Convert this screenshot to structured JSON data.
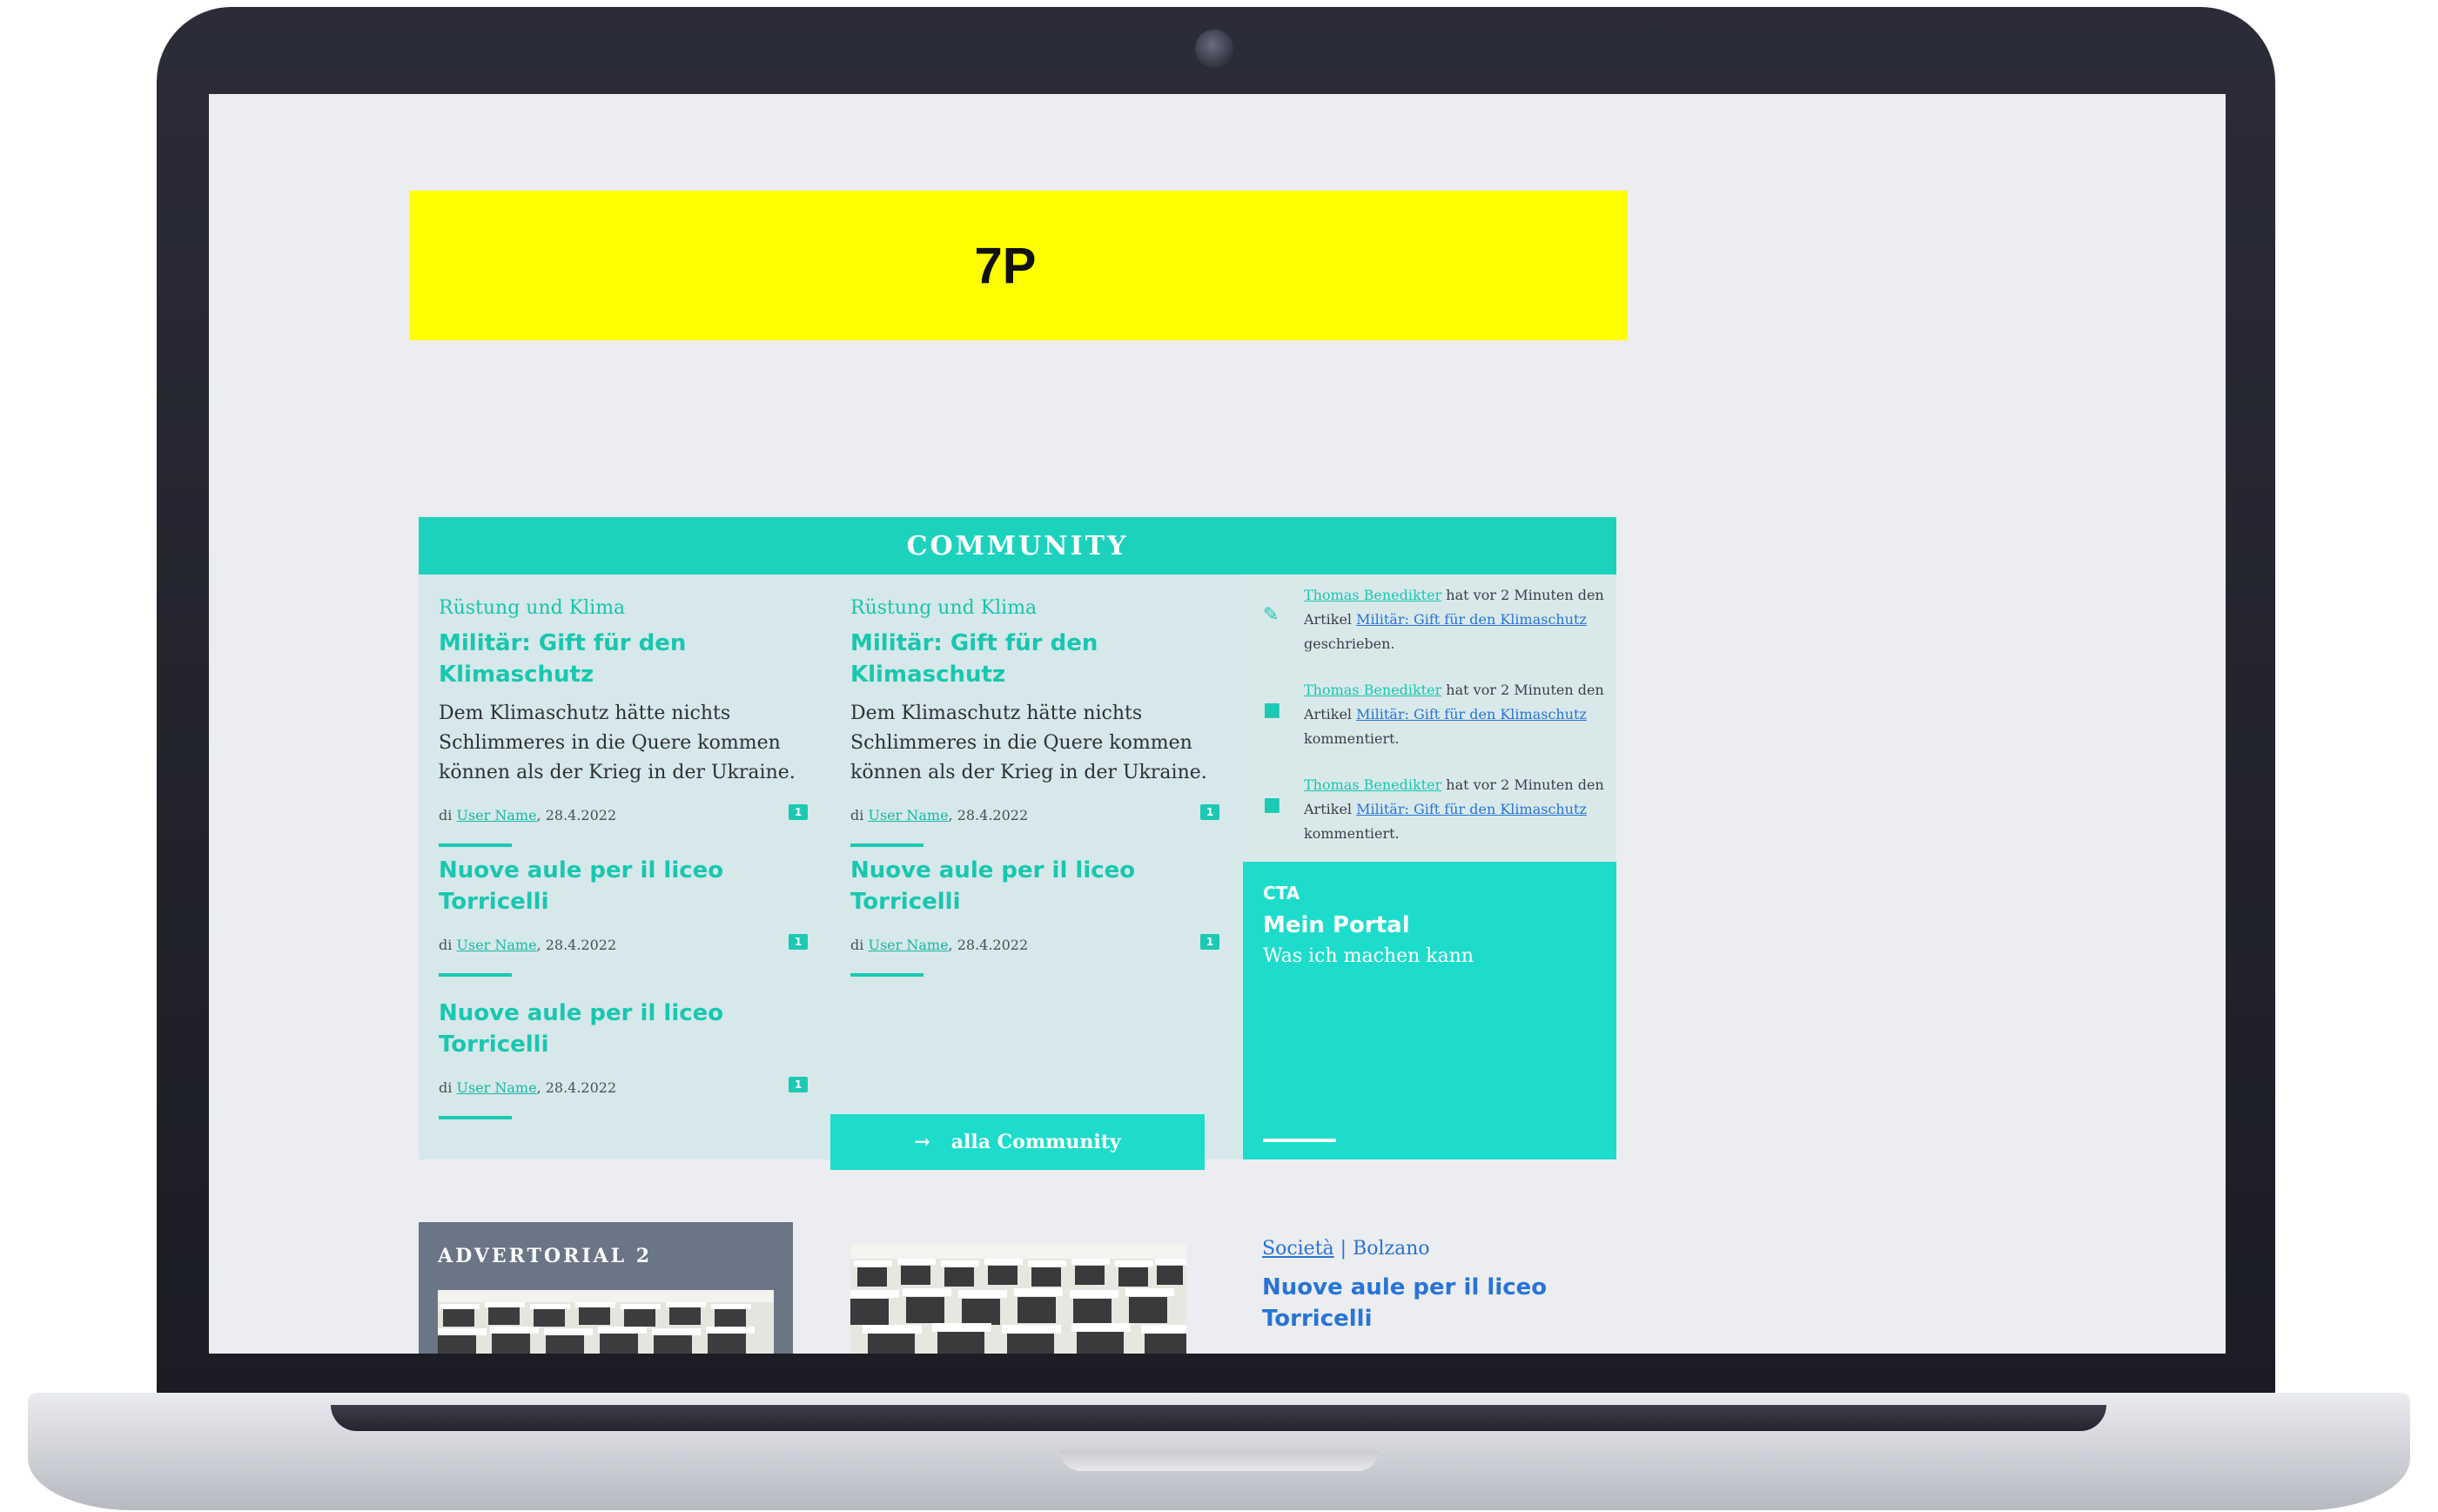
{
  "ad_banner": {
    "label": "7P"
  },
  "community": {
    "header": "COMMUNITY",
    "button_label": "alla Community",
    "articles": [
      {
        "category": "Rüstung und Klima",
        "title": "Militär: Gift für den Klimaschutz",
        "text": "Dem Klimaschutz hätte nichts Schlimmeres in die Quere kommen können als der Krieg in der Ukraine.",
        "meta_prefix": "di ",
        "author": "User Name",
        "date": ", 28.4.2022",
        "comments": "1"
      },
      {
        "category": "Rüstung und Klima",
        "title": "Militär: Gift für den Klimaschutz",
        "text": "Dem Klimaschutz hätte nichts Schlimmeres in die Quere kommen können als der Krieg in der Ukraine.",
        "meta_prefix": "di ",
        "author": "User Name",
        "date": ", 28.4.2022",
        "comments": "1"
      },
      {
        "title": "Nuove aule per il liceo Torricelli",
        "meta_prefix": "di ",
        "author": "User Name",
        "date": ", 28.4.2022",
        "comments": "1"
      },
      {
        "title": "Nuove aule per il liceo Torricelli",
        "meta_prefix": "di ",
        "author": "User Name",
        "date": ", 28.4.2022",
        "comments": "1"
      },
      {
        "title": "Nuove aule per il liceo Torricelli",
        "meta_prefix": "di ",
        "author": "User Name",
        "date": ", 28.4.2022",
        "comments": "1"
      }
    ],
    "feed": [
      {
        "icon": "edit-icon",
        "user": "Thomas Benedikter",
        "text_1": " hat vor 2 Minuten den Artikel ",
        "article": "Militär: Gift für den Klimaschutz",
        "text_2": " geschrieben."
      },
      {
        "icon": "comment-icon",
        "user": "Thomas Benedikter",
        "text_1": " hat vor 2 Minuten den Artikel ",
        "article": "Militär: Gift für den Klimaschutz",
        "text_2": " kommentiert."
      },
      {
        "icon": "comment-icon",
        "user": "Thomas Benedikter",
        "text_1": " hat vor 2 Minuten den Artikel ",
        "article": "Militär: Gift für den Klimaschutz",
        "text_2": " kommentiert."
      }
    ],
    "cta": {
      "label": "CTA",
      "title": "Mein Portal",
      "subtitle": "Was ich machen kann"
    }
  },
  "advertorial": {
    "label": "ADVERTORIAL 2"
  },
  "bottom_article": {
    "category_1": "Società",
    "separator": " | ",
    "category_2": "Bolzano",
    "title": "Nuove aule per il liceo Torricelli"
  },
  "colors": {
    "accent": "#1dd2bd",
    "link_blue": "#2874d6",
    "banner_yellow": "#ffff00",
    "advertorial_bg": "#6a7586"
  }
}
